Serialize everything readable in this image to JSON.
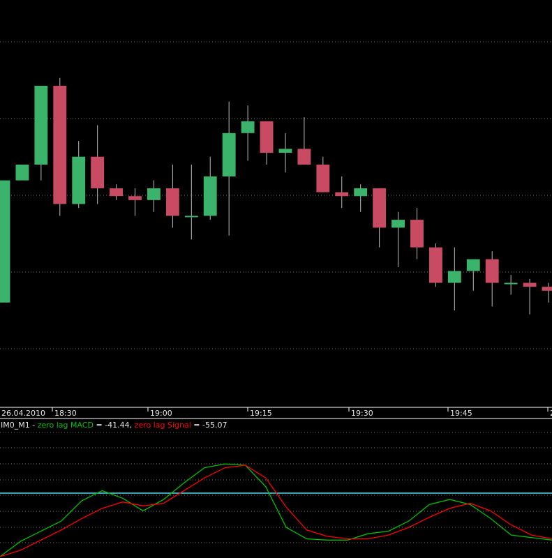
{
  "window": {
    "date_label": "26.04.2010",
    "indicator_prefix": "IM0_M1 - ",
    "macd_label": "zero lag MACD",
    "macd_value_text": " = -41.44, ",
    "signal_label": "zero lag Signal",
    "signal_value_text": " = -55.07"
  },
  "colors": {
    "background": "#000000",
    "bull": "#3bb36a",
    "bear": "#c94b63",
    "wick": "#bdbdbd",
    "grid": "#7a7a7a",
    "axis": "#ffffff",
    "macd": "#00c000",
    "signal": "#ff0000",
    "zero_line": "#4fd8e8",
    "legend_text": "#e6e6e6"
  },
  "chart_data": [
    {
      "type": "candlestick",
      "title": "",
      "time_labels": [
        "18:30",
        "19:00",
        "19:15",
        "19:30",
        "19:45",
        "2"
      ],
      "grid": true,
      "y_axis_shown": false,
      "candles": [
        {
          "open": 0.25,
          "high": 0.27,
          "low": 0.6,
          "close": 0.56
        },
        {
          "open": 0.56,
          "high": 0.51,
          "low": 0.64,
          "close": 0.6
        },
        {
          "open": 0.6,
          "high": 0.8,
          "low": 0.56,
          "close": 0.8
        },
        {
          "open": 0.8,
          "high": 0.82,
          "low": 0.47,
          "close": 0.5
        },
        {
          "open": 0.5,
          "high": 0.66,
          "low": 0.49,
          "close": 0.62
        },
        {
          "open": 0.62,
          "high": 0.7,
          "low": 0.5,
          "close": 0.54
        },
        {
          "open": 0.54,
          "high": 0.55,
          "low": 0.51,
          "close": 0.52
        },
        {
          "open": 0.52,
          "high": 0.54,
          "low": 0.47,
          "close": 0.51
        },
        {
          "open": 0.51,
          "high": 0.56,
          "low": 0.48,
          "close": 0.54
        },
        {
          "open": 0.54,
          "high": 0.6,
          "low": 0.44,
          "close": 0.47
        },
        {
          "open": 0.47,
          "high": 0.6,
          "low": 0.41,
          "close": 0.47
        },
        {
          "open": 0.47,
          "high": 0.62,
          "low": 0.46,
          "close": 0.57
        },
        {
          "open": 0.57,
          "high": 0.76,
          "low": 0.42,
          "close": 0.68
        },
        {
          "open": 0.68,
          "high": 0.75,
          "low": 0.61,
          "close": 0.71
        },
        {
          "open": 0.71,
          "high": 0.68,
          "low": 0.6,
          "close": 0.63
        },
        {
          "open": 0.63,
          "high": 0.68,
          "low": 0.58,
          "close": 0.64
        },
        {
          "open": 0.64,
          "high": 0.72,
          "low": 0.62,
          "close": 0.6
        },
        {
          "open": 0.6,
          "high": 0.62,
          "low": 0.56,
          "close": 0.53
        },
        {
          "open": 0.53,
          "high": 0.57,
          "low": 0.49,
          "close": 0.52
        },
        {
          "open": 0.52,
          "high": 0.55,
          "low": 0.48,
          "close": 0.54
        },
        {
          "open": 0.54,
          "high": 0.48,
          "low": 0.39,
          "close": 0.44
        },
        {
          "open": 0.44,
          "high": 0.48,
          "low": 0.34,
          "close": 0.46
        },
        {
          "open": 0.46,
          "high": 0.49,
          "low": 0.36,
          "close": 0.39
        },
        {
          "open": 0.39,
          "high": 0.4,
          "low": 0.29,
          "close": 0.3
        },
        {
          "open": 0.3,
          "high": 0.39,
          "low": 0.23,
          "close": 0.33
        },
        {
          "open": 0.33,
          "high": 0.35,
          "low": 0.28,
          "close": 0.36
        },
        {
          "open": 0.36,
          "high": 0.38,
          "low": 0.24,
          "close": 0.3
        },
        {
          "open": 0.3,
          "high": 0.32,
          "low": 0.27,
          "close": 0.3
        },
        {
          "open": 0.3,
          "high": 0.31,
          "low": 0.22,
          "close": 0.29
        },
        {
          "open": 0.29,
          "high": 0.3,
          "low": 0.25,
          "close": 0.28
        }
      ]
    },
    {
      "type": "line",
      "title": "IM0_M1",
      "grid": true,
      "zero_line": true,
      "series": [
        {
          "name": "zero lag MACD",
          "values": [
            0.0,
            0.12,
            0.2,
            0.28,
            0.44,
            0.52,
            0.46,
            0.36,
            0.45,
            0.58,
            0.7,
            0.73,
            0.72,
            0.55,
            0.23,
            0.14,
            0.13,
            0.13,
            0.18,
            0.2,
            0.28,
            0.41,
            0.45,
            0.41,
            0.3,
            0.17,
            0.15,
            0.13
          ]
        },
        {
          "name": "zero lag Signal",
          "values": [
            0.0,
            0.05,
            0.13,
            0.21,
            0.3,
            0.38,
            0.43,
            0.4,
            0.42,
            0.52,
            0.62,
            0.7,
            0.72,
            0.62,
            0.39,
            0.21,
            0.16,
            0.14,
            0.14,
            0.17,
            0.23,
            0.31,
            0.38,
            0.42,
            0.36,
            0.25,
            0.17,
            0.14
          ]
        }
      ],
      "latest": {
        "zero lag MACD": -41.44,
        "zero lag Signal": -55.07
      }
    }
  ]
}
